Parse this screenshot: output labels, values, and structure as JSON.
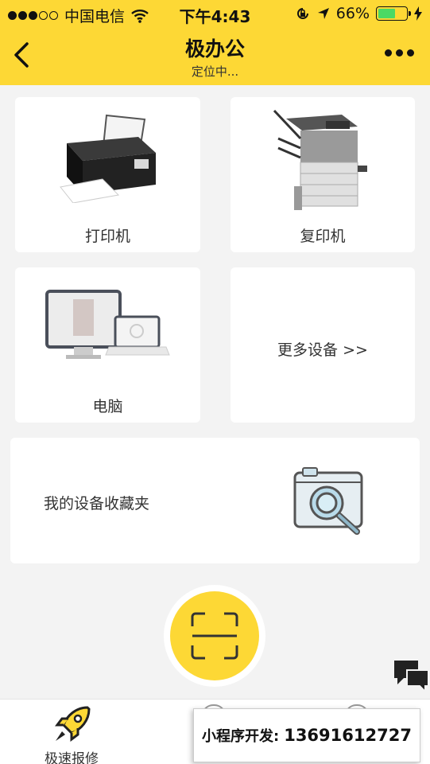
{
  "status_bar": {
    "carrier": "中国电信",
    "time": "下午4:43",
    "battery": "66%",
    "battery_level": 0.66,
    "signal_bars": 3
  },
  "nav": {
    "title": "极办公",
    "subtitle": "定位中..."
  },
  "devices": [
    {
      "label": "打印机",
      "icon": "printer-icon"
    },
    {
      "label": "复印机",
      "icon": "copier-icon"
    },
    {
      "label": "电脑",
      "icon": "computer-icon"
    },
    {
      "label": "更多设备 >>"
    }
  ],
  "favorites": {
    "label": "我的设备收藏夹",
    "icon": "camera-search-icon"
  },
  "scan": {
    "icon": "scan-icon",
    "color": "#fdd835"
  },
  "tabbar": {
    "items": [
      {
        "label": "极速报修",
        "icon": "rocket-icon"
      }
    ]
  },
  "promo": {
    "label": "小程序开发:",
    "phone": "13691612727"
  },
  "colors": {
    "accent": "#fdd835",
    "background": "#f3f3f3"
  }
}
